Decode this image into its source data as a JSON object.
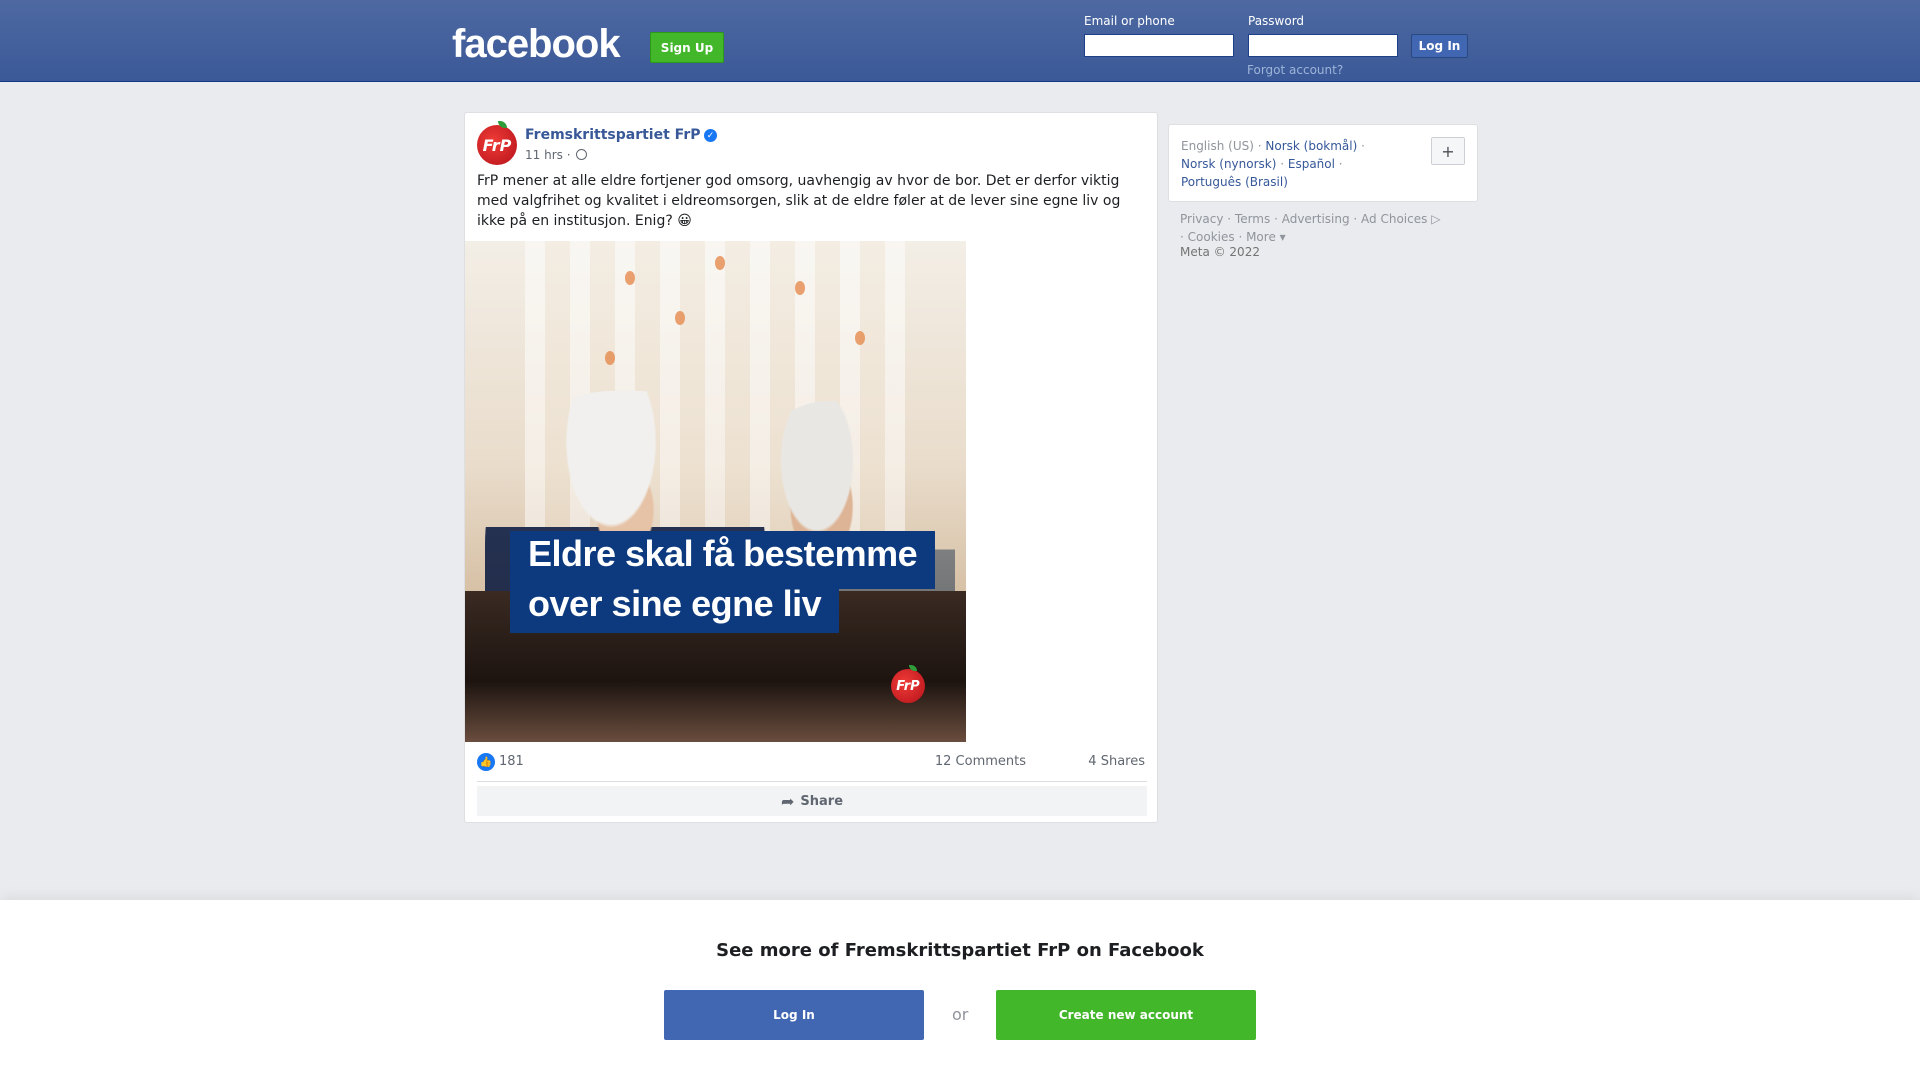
{
  "header": {
    "logo": "facebook",
    "signup_label": "Sign Up",
    "email_label": "Email or phone",
    "password_label": "Password",
    "login_label": "Log In",
    "forgot_label": "Forgot account?",
    "email_value": "",
    "password_value": ""
  },
  "post": {
    "page_name": "Fremskrittspartiet FrP",
    "avatar_text": "FrP",
    "time": "11 hrs",
    "time_separator": "·",
    "text": "FrP mener at alle eldre fortjener god omsorg, uavhengig av hvor de bor. Det er derfor viktig med valgfrihet og kvalitet i eldreomsorgen, slik at de eldre føler at de lever sine egne liv og ikke på en institusjon. Enig? 😀",
    "image": {
      "banner_line1": "Eldre skal få bestemme",
      "banner_line2": "over sine egne liv",
      "logo_text": "FrP"
    },
    "reactions": "181",
    "comments": "12 Comments",
    "shares": "4 Shares",
    "share_label": "Share"
  },
  "sidebar": {
    "languages": {
      "current": "English (US)",
      "links": [
        "Norsk (bokmål)",
        "Norsk (nynorsk)",
        "Español",
        "Português (Brasil)"
      ],
      "plus": "+"
    },
    "footer_links": [
      "Privacy",
      "Terms",
      "Advertising",
      "Ad Choices",
      "Cookies",
      "More"
    ],
    "copyright": "Meta © 2022"
  },
  "bottom": {
    "heading": "See more of Fremskrittspartiet FrP on Facebook",
    "login_label": "Log In",
    "or_label": "or",
    "create_label": "Create new account"
  },
  "colors": {
    "brand_blue": "#3b5998",
    "button_blue": "#4267b2",
    "green": "#42b72a",
    "link": "#385898"
  },
  "icons": {
    "verified": "verified-check-icon",
    "audience": "globe-icon",
    "like": "thumbs-up-icon",
    "share": "share-arrow-icon",
    "ad_choices": "ad-choices-icon"
  }
}
